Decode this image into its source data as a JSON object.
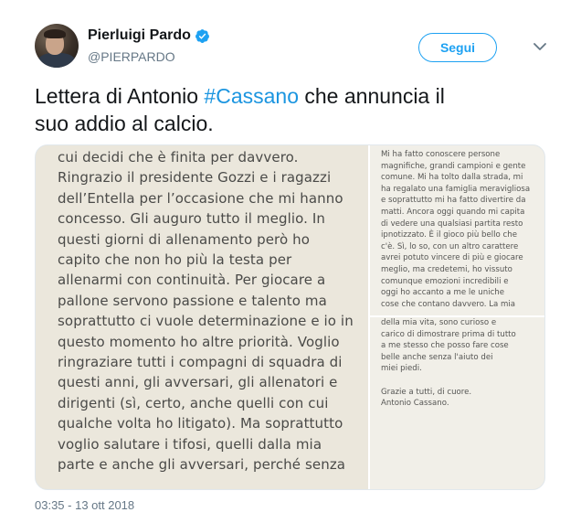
{
  "author": {
    "name": "Pierluigi Pardo",
    "handle": "@PIERPARDO",
    "verified": true
  },
  "follow_button": {
    "label": "Segui"
  },
  "tweet": {
    "text_before": "Lettera di Antonio ",
    "hashtag": "#Cassano",
    "text_after_line1": " che annuncia il",
    "text_line2": "suo addio al calcio."
  },
  "media": {
    "left_photo_lines": [
      "cui decidi che è finita per davvero.",
      "Ringrazio il presidente Gozzi e i ragazzi",
      "dell’Entella per l’occasione che mi hanno",
      "concesso. Gli auguro tutto il meglio. In",
      "questi giorni di allenamento però ho",
      "capito che non ho più la testa per",
      "allenarmi con continuità. Per giocare a",
      "pallone servono passione e talento ma",
      "soprattutto ci vuole determinazione e io in",
      "questo momento ho altre priorità. Voglio",
      "ringraziare tutti i compagni di squadra di",
      "questi anni, gli avversari, gli allenatori e",
      "dirigenti (sì, certo, anche quelli con cui",
      "qualche volta ho litigato). Ma soprattutto",
      "voglio salutare i tifosi, quelli dalla mia",
      "parte e anche gli avversari, perché senza"
    ],
    "top_right_lines": [
      "Mi ha fatto conoscere persone",
      "magnifiche, grandi campioni e gente",
      "comune. Mi ha tolto dalla strada, mi",
      "ha regalato una famiglia meravigliosa",
      "e soprattutto mi ha fatto divertire da",
      "matti. Ancora oggi quando mi capita",
      "di vedere una qualsiasi partita resto",
      "ipnotizzato. È il gioco più bello che",
      "c'è. Sì, lo so, con un altro carattere",
      "avrei potuto vincere di più e giocare",
      "meglio, ma credetemi, ho vissuto",
      "comunque emozioni incredibili e",
      "oggi ho accanto a me le uniche",
      "cose che contano davvero. La mia"
    ],
    "bottom_right_lines": [
      "della mia vita, sono curioso e",
      "carico di dimostrare prima di tutto",
      "a me stesso che posso fare cose",
      "belle anche senza l'aiuto dei",
      "miei piedi.",
      "",
      "Grazie a tutti, di cuore.",
      "Antonio Cassano."
    ]
  },
  "timestamp": "03:35 - 13 ott 2018",
  "colors": {
    "accent": "#1da1f2",
    "hashtag": "#1b95e0",
    "secondary_text": "#657786"
  }
}
